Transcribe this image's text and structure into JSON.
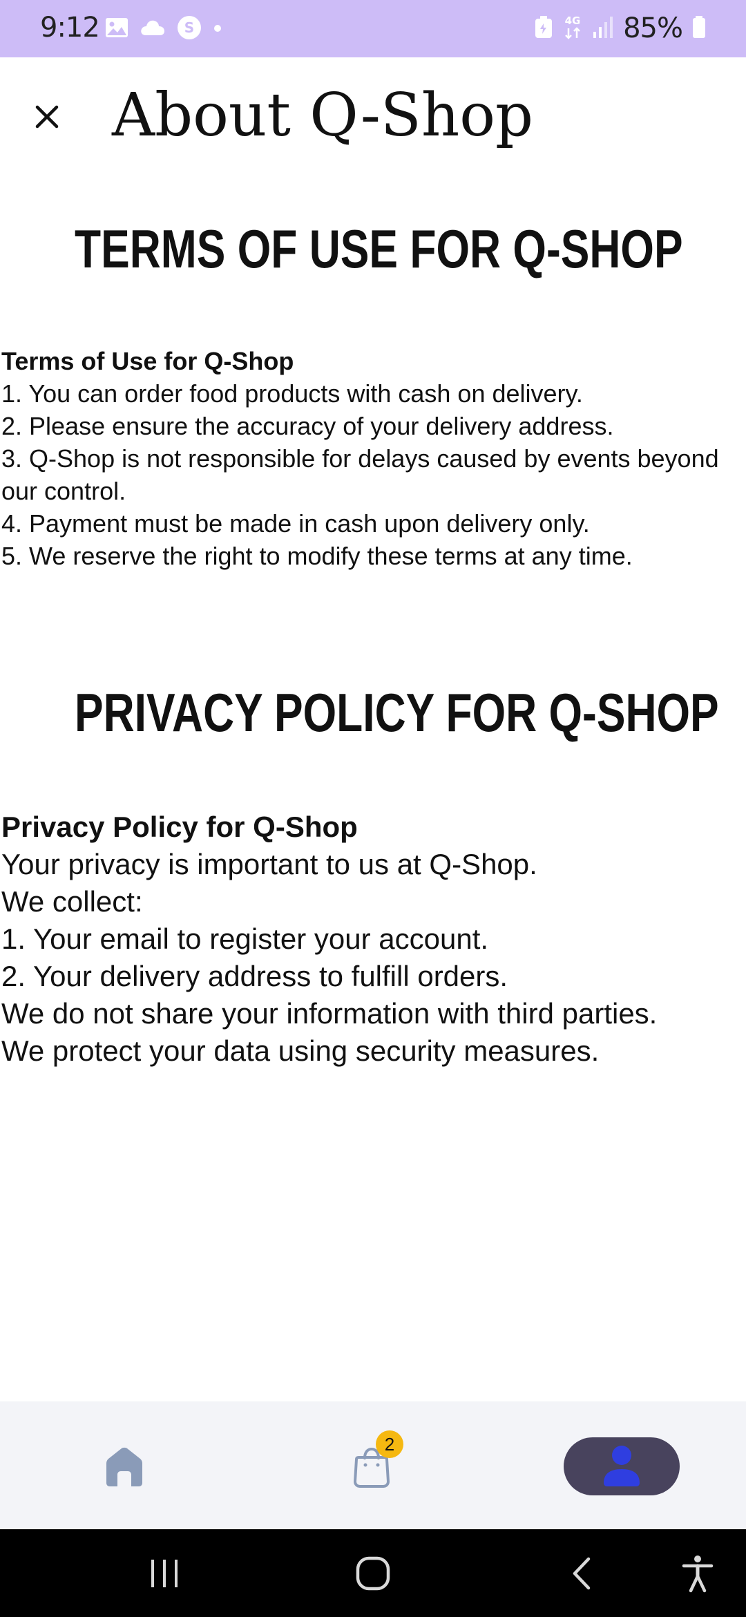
{
  "status_bar": {
    "time": "9:12",
    "battery_percent": "85%",
    "network": "4G",
    "left_icons": [
      "gallery-icon",
      "cloud-icon",
      "s-app-icon",
      "dot-icon"
    ],
    "right_icons": [
      "battery-saver-icon",
      "network-4g-icon",
      "signal-icon",
      "battery-icon"
    ],
    "background": "#cdbcf7"
  },
  "header": {
    "title": "About Q-Shop",
    "close_icon": "close-icon"
  },
  "terms": {
    "heading": "TERMS OF USE FOR Q-SHOP",
    "title": "Terms of Use for Q-Shop",
    "lines": [
      "1. You can order food products with cash on delivery.",
      "2. Please ensure the accuracy of your delivery address.",
      "3. Q-Shop is not responsible for delays caused by events beyond our control.",
      "4. Payment must be made in cash upon delivery only.",
      "5. We reserve the right to modify these terms at any time."
    ]
  },
  "privacy": {
    "heading": "PRIVACY POLICY FOR Q-SHOP",
    "title": "Privacy Policy for Q-Shop",
    "lines": [
      "Your privacy is important to us at Q-Shop.",
      "We collect:",
      "1. Your email to register your account.",
      "2. Your delivery address to fulfill orders.",
      "We do not share your information with third parties.",
      "We protect your data using security measures."
    ]
  },
  "bottom_nav": {
    "items": [
      {
        "name": "home",
        "icon": "home-icon"
      },
      {
        "name": "cart",
        "icon": "bag-icon",
        "badge": "2"
      },
      {
        "name": "profile",
        "icon": "person-icon",
        "active": true
      }
    ],
    "background": "#f3f4f8",
    "active_pill_color": "#48435d",
    "active_icon_color": "#2f3ee0",
    "inactive_icon_color": "#8a9bb8",
    "badge_color": "#f5b811"
  },
  "system_nav": {
    "buttons": [
      "recents-icon",
      "home-circle-icon",
      "back-icon",
      "accessibility-icon"
    ]
  }
}
